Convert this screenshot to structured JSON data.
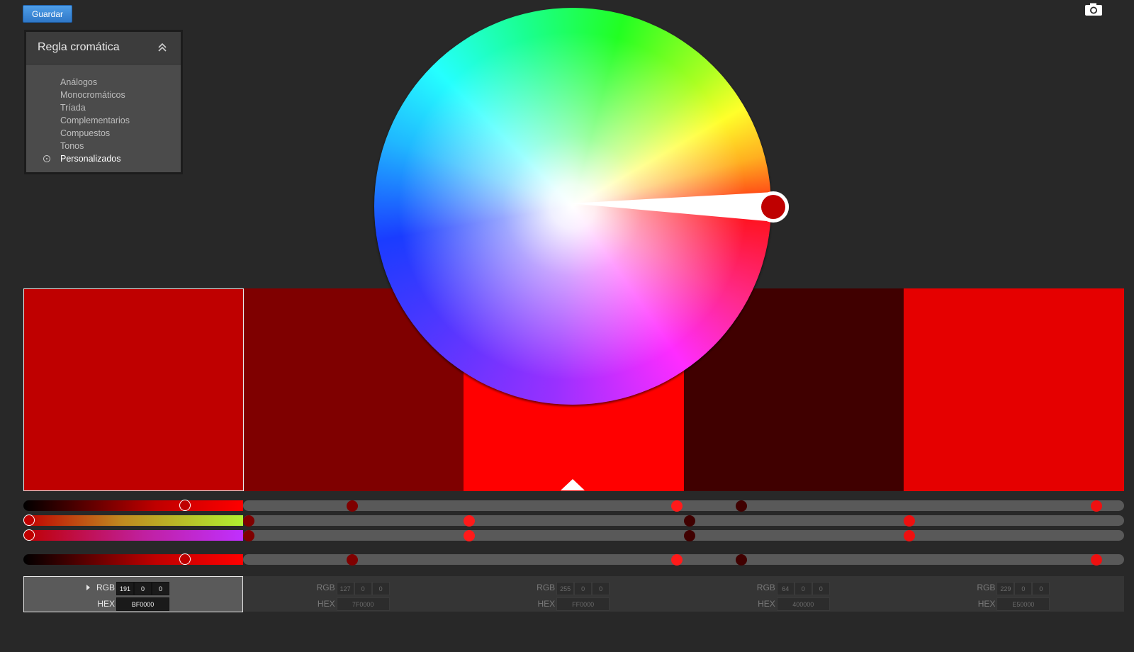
{
  "toolbar": {
    "save_label": "Guardar",
    "camera_icon": "camera-icon"
  },
  "rule_panel": {
    "title": "Regla cromática",
    "collapse_icon": "double-chevron-up-icon",
    "items": [
      {
        "label": "Análogos",
        "selected": false
      },
      {
        "label": "Monocromáticos",
        "selected": false
      },
      {
        "label": "Tríada",
        "selected": false
      },
      {
        "label": "Complementarios",
        "selected": false
      },
      {
        "label": "Compuestos",
        "selected": false
      },
      {
        "label": "Tonos",
        "selected": false
      },
      {
        "label": "Personalizados",
        "selected": true
      }
    ]
  },
  "swatches": [
    {
      "color": "#BF0000",
      "rgb": [
        "191",
        "0",
        "0"
      ],
      "hex": "BF0000",
      "selected": true
    },
    {
      "color": "#7F0000",
      "rgb": [
        "127",
        "0",
        "0"
      ],
      "hex": "7F0000",
      "selected": false
    },
    {
      "color": "#FF0000",
      "rgb": [
        "255",
        "0",
        "0"
      ],
      "hex": "FF0000",
      "selected": false,
      "base": true
    },
    {
      "color": "#400000",
      "rgb": [
        "64",
        "0",
        "0"
      ],
      "hex": "400000",
      "selected": false
    },
    {
      "color": "#E50000",
      "rgb": [
        "229",
        "0",
        "0"
      ],
      "hex": "E50000",
      "selected": false
    }
  ],
  "labels": {
    "rgb": "RGB",
    "hex": "HEX"
  },
  "colors": {
    "background": "#282828",
    "accent": "#3a8ad9",
    "wheel_handle": "#BF0000"
  }
}
